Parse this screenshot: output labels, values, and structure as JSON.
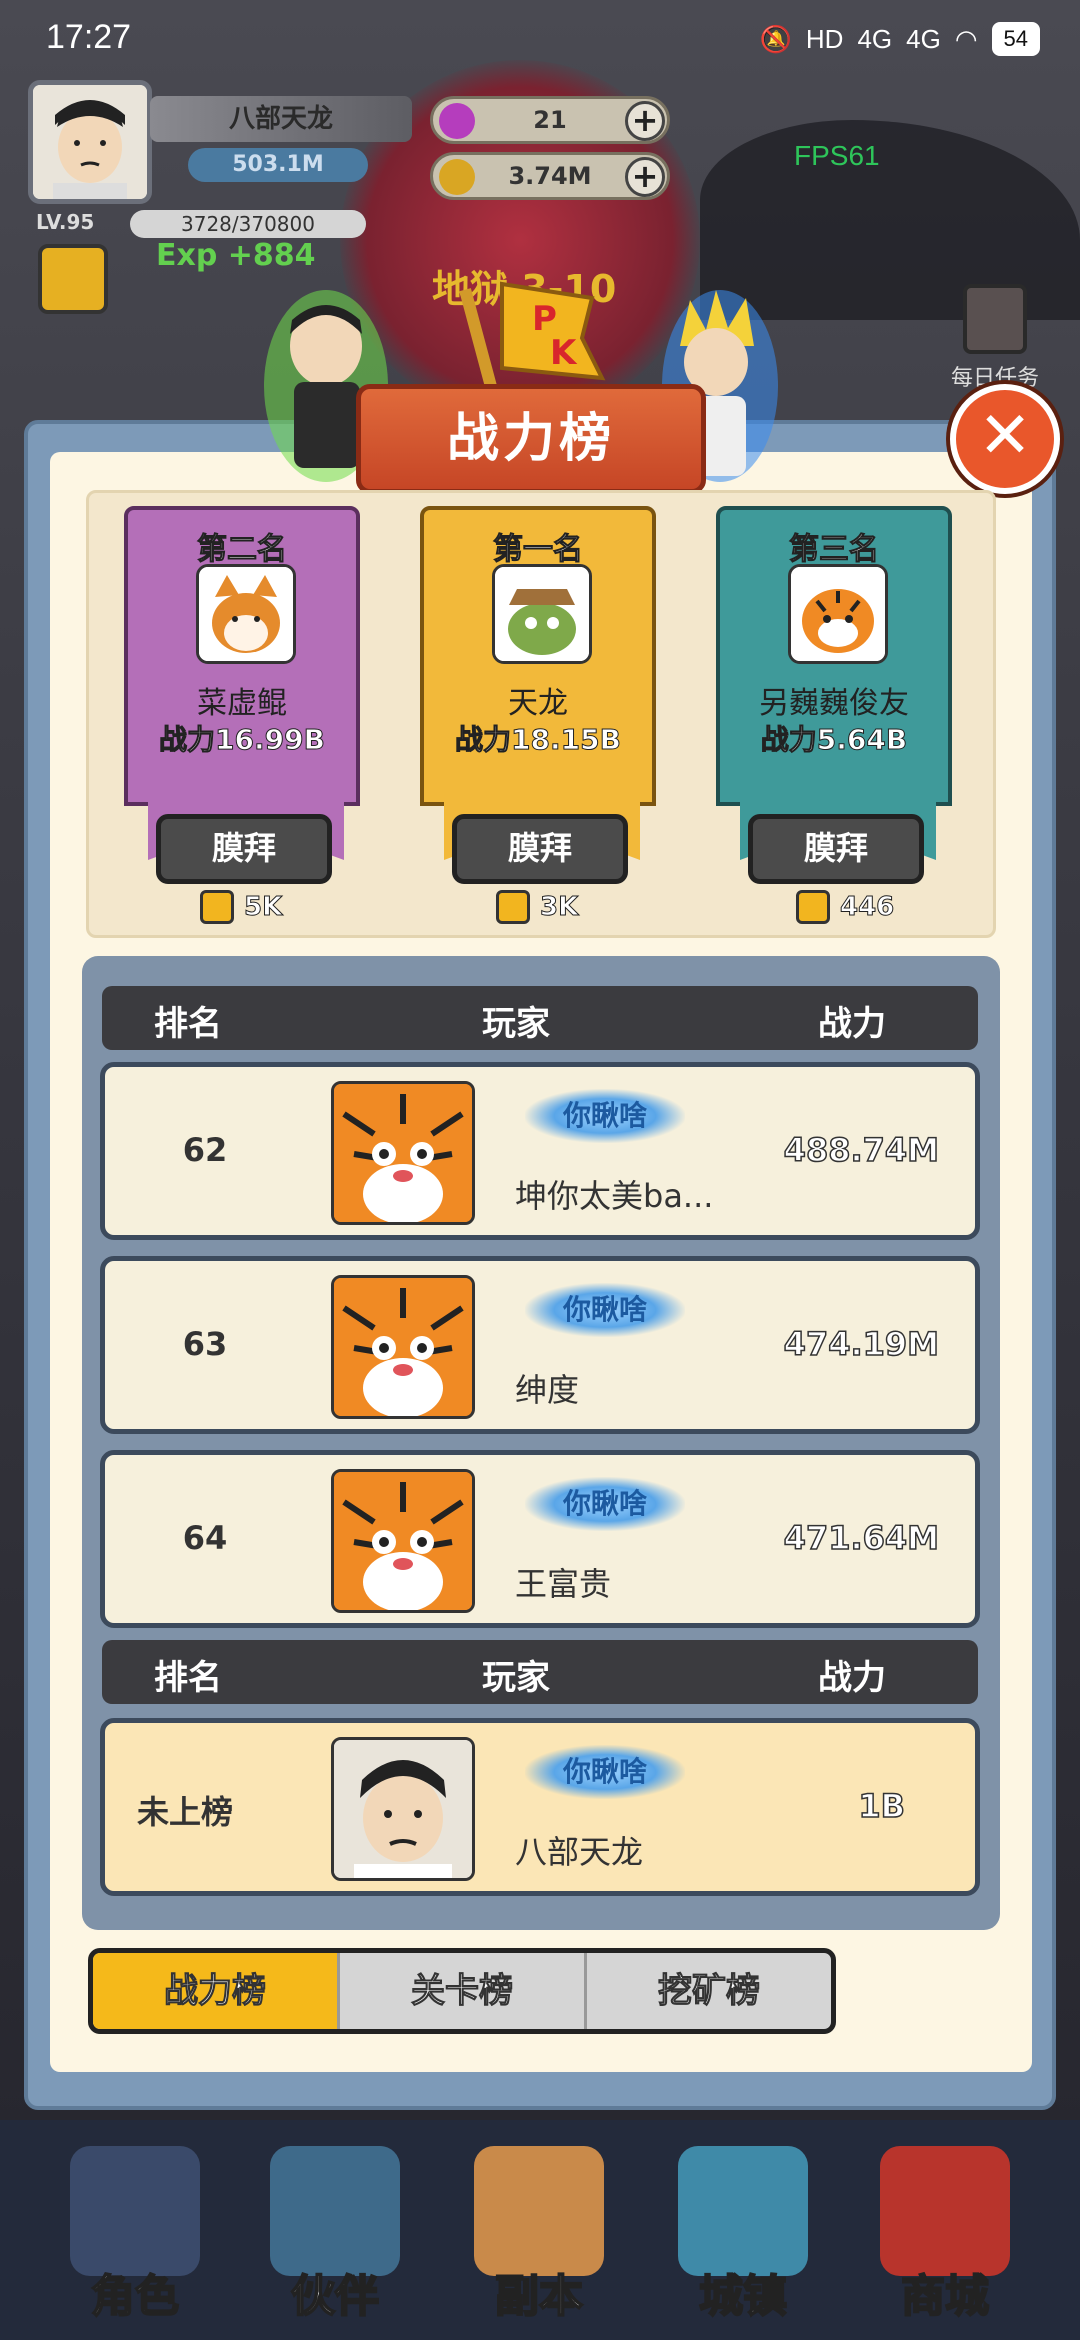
{
  "status_bar": {
    "time": "17:27",
    "network_icons": [
      "HD",
      "4G",
      "4G"
    ],
    "battery": "54"
  },
  "player_hud": {
    "name": "八部天龙",
    "power": "503.1M",
    "level": "LV.95",
    "exp_progress": "3728/370800",
    "exp_gain": "Exp +884",
    "gems": "21",
    "gold": "3.74M",
    "stage": "地狱 3-10",
    "fps": "FPS61",
    "daily_task": "每日任务"
  },
  "leaderboard": {
    "title": "战力榜",
    "podium": [
      {
        "place": "第二名",
        "name": "菜虚鲲",
        "power": "战力16.99B",
        "worship": "膜拜",
        "likes": "5K",
        "color": "#b46fb8"
      },
      {
        "place": "第一名",
        "name": "天龙",
        "power": "战力18.15B",
        "worship": "膜拜",
        "likes": "3K",
        "color": "#f2b93a"
      },
      {
        "place": "第三名",
        "name": "另巍巍俊友",
        "power": "战力5.64B",
        "worship": "膜拜",
        "likes": "446",
        "color": "#3f9a9a"
      }
    ],
    "headers": {
      "rank": "排名",
      "player": "玩家",
      "power": "战力"
    },
    "rows": [
      {
        "rank": "62",
        "title": "你瞅啥",
        "name": "坤你太美ba...",
        "power": "488.74M"
      },
      {
        "rank": "63",
        "title": "你瞅啥",
        "name": "绅度",
        "power": "474.19M"
      },
      {
        "rank": "64",
        "title": "你瞅啥",
        "name": "王富贵",
        "power": "471.64M"
      }
    ],
    "mine": {
      "rank": "未上榜",
      "title": "你瞅啥",
      "name": "八部天龙",
      "power": "1B"
    },
    "tabs": [
      "战力榜",
      "关卡榜",
      "挖矿榜"
    ]
  },
  "bottom_nav": [
    "角色",
    "伙伴",
    "副本",
    "城镇",
    "商城"
  ]
}
